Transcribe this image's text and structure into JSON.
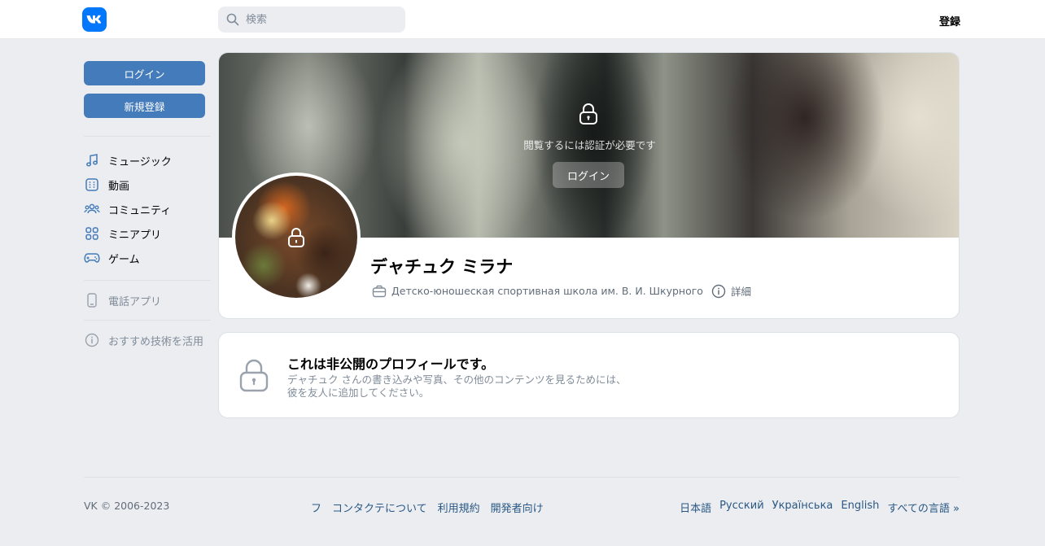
{
  "header": {
    "logo_icon": "vk-logo-icon",
    "search_placeholder": "検索",
    "register_label": "登録"
  },
  "sidebar": {
    "login_label": "ログイン",
    "signup_label": "新規登録",
    "nav": [
      {
        "label": "ミュージック",
        "icon": "music-icon"
      },
      {
        "label": "動画",
        "icon": "video-icon"
      },
      {
        "label": "コミュニティ",
        "icon": "community-icon"
      },
      {
        "label": "ミニアプリ",
        "icon": "mini-apps-icon"
      },
      {
        "label": "ゲーム",
        "icon": "gamepad-icon"
      }
    ],
    "phone_app_label": "電話アプリ",
    "recommend_label": "おすすめ技術を活用"
  },
  "profile": {
    "cover_text": "閲覧するには認証が必要です",
    "cover_login_label": "ログイン",
    "name": "デャチュク ミラナ",
    "workplace": "Детско-юношеская спортивная школа им. В. И. Шкурного",
    "details_label": "詳細"
  },
  "private_notice": {
    "title": "これは非公開のプロフィールです。",
    "description": "デャチュク さんの書き込みや写真、その他のコンテンツを見るためには、彼を友人に追加してください。"
  },
  "footer": {
    "copyright": "VK © 2006-2023",
    "links": [
      "フ",
      "コンタクテについて",
      "利用規約",
      "開発者向け"
    ],
    "languages": [
      "日本語",
      "Русский",
      "Українська",
      "English",
      "すべての言語 »"
    ]
  },
  "colors": {
    "accent": "#447bba",
    "brand": "#0077ff",
    "link": "#2a5885",
    "background": "#ebedf0"
  }
}
